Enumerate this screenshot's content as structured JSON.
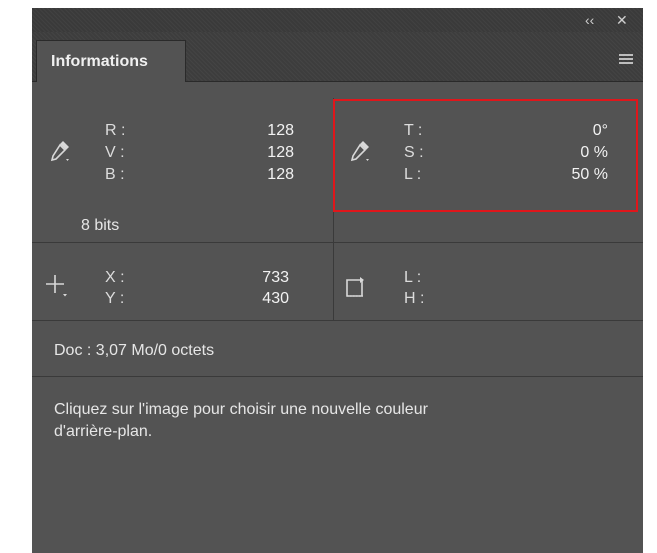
{
  "titlebar": {
    "collapse_icon": "‹‹",
    "close_icon": "✕"
  },
  "tab": {
    "label": "Informations"
  },
  "color1": {
    "labels": [
      "R :",
      "V :",
      "B :"
    ],
    "values": [
      "128",
      "128",
      "128"
    ],
    "bit_depth": "8 bits"
  },
  "color2": {
    "labels": [
      "T :",
      "S :",
      "L :"
    ],
    "values": [
      "0°",
      "0 %",
      "50 %"
    ]
  },
  "position": {
    "labels": [
      "X :",
      "Y :"
    ],
    "values": [
      "733",
      "430"
    ]
  },
  "size": {
    "labels": [
      "L :",
      "H :"
    ]
  },
  "doc": {
    "text": "Doc : 3,07 Mo/0 octets"
  },
  "hint": {
    "line1": "Cliquez sur l'image pour choisir une nouvelle couleur",
    "line2": "d'arrière-plan."
  },
  "colors": {
    "panel_bg": "#535353",
    "highlight": "#e0161b"
  }
}
